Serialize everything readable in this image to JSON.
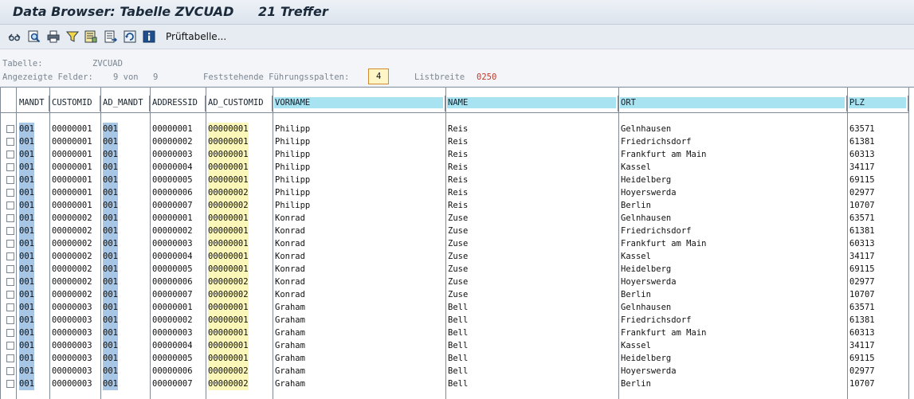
{
  "window": {
    "title": "Data Browser: Tabelle ZVCUAD",
    "hits": "21 Treffer"
  },
  "toolbar": {
    "icons": [
      "glasses-icon",
      "find-icon",
      "print-icon",
      "filter-icon",
      "layout-icon",
      "export-icon",
      "refresh-icon",
      "info-icon"
    ],
    "check_table_label": "Prüftabelle..."
  },
  "info": {
    "table_label": "Tabelle:",
    "table_value": "ZVCUAD",
    "fields_label": "Angezeigte Felder:",
    "fields_value": "9 von",
    "fields_total": "9",
    "fixed_cols_label": "Feststehende Führungsspalten:",
    "fixed_cols_value": "4",
    "list_width_label": "Listbreite",
    "list_width_value": "0250"
  },
  "table": {
    "columns": [
      "MANDT",
      "CUSTOMID",
      "AD_MANDT",
      "ADDRESSID",
      "AD_CUSTOMID",
      "VORNAME",
      "NAME",
      "ORT",
      "PLZ"
    ],
    "rows": [
      [
        "001",
        "00000001",
        "001",
        "00000001",
        "00000001",
        "Philipp",
        "Reis",
        "Gelnhausen",
        "63571"
      ],
      [
        "001",
        "00000001",
        "001",
        "00000002",
        "00000001",
        "Philipp",
        "Reis",
        "Friedrichsdorf",
        "61381"
      ],
      [
        "001",
        "00000001",
        "001",
        "00000003",
        "00000001",
        "Philipp",
        "Reis",
        "Frankfurt am Main",
        "60313"
      ],
      [
        "001",
        "00000001",
        "001",
        "00000004",
        "00000001",
        "Philipp",
        "Reis",
        "Kassel",
        "34117"
      ],
      [
        "001",
        "00000001",
        "001",
        "00000005",
        "00000001",
        "Philipp",
        "Reis",
        "Heidelberg",
        "69115"
      ],
      [
        "001",
        "00000001",
        "001",
        "00000006",
        "00000002",
        "Philipp",
        "Reis",
        "Hoyerswerda",
        "02977"
      ],
      [
        "001",
        "00000001",
        "001",
        "00000007",
        "00000002",
        "Philipp",
        "Reis",
        "Berlin",
        "10707"
      ],
      [
        "001",
        "00000002",
        "001",
        "00000001",
        "00000001",
        "Konrad",
        "Zuse",
        "Gelnhausen",
        "63571"
      ],
      [
        "001",
        "00000002",
        "001",
        "00000002",
        "00000001",
        "Konrad",
        "Zuse",
        "Friedrichsdorf",
        "61381"
      ],
      [
        "001",
        "00000002",
        "001",
        "00000003",
        "00000001",
        "Konrad",
        "Zuse",
        "Frankfurt am Main",
        "60313"
      ],
      [
        "001",
        "00000002",
        "001",
        "00000004",
        "00000001",
        "Konrad",
        "Zuse",
        "Kassel",
        "34117"
      ],
      [
        "001",
        "00000002",
        "001",
        "00000005",
        "00000001",
        "Konrad",
        "Zuse",
        "Heidelberg",
        "69115"
      ],
      [
        "001",
        "00000002",
        "001",
        "00000006",
        "00000002",
        "Konrad",
        "Zuse",
        "Hoyerswerda",
        "02977"
      ],
      [
        "001",
        "00000002",
        "001",
        "00000007",
        "00000002",
        "Konrad",
        "Zuse",
        "Berlin",
        "10707"
      ],
      [
        "001",
        "00000003",
        "001",
        "00000001",
        "00000001",
        "Graham",
        "Bell",
        "Gelnhausen",
        "63571"
      ],
      [
        "001",
        "00000003",
        "001",
        "00000002",
        "00000001",
        "Graham",
        "Bell",
        "Friedrichsdorf",
        "61381"
      ],
      [
        "001",
        "00000003",
        "001",
        "00000003",
        "00000001",
        "Graham",
        "Bell",
        "Frankfurt am Main",
        "60313"
      ],
      [
        "001",
        "00000003",
        "001",
        "00000004",
        "00000001",
        "Graham",
        "Bell",
        "Kassel",
        "34117"
      ],
      [
        "001",
        "00000003",
        "001",
        "00000005",
        "00000001",
        "Graham",
        "Bell",
        "Heidelberg",
        "69115"
      ],
      [
        "001",
        "00000003",
        "001",
        "00000006",
        "00000002",
        "Graham",
        "Bell",
        "Hoyerswerda",
        "02977"
      ],
      [
        "001",
        "00000003",
        "001",
        "00000007",
        "00000002",
        "Graham",
        "Bell",
        "Berlin",
        "10707"
      ]
    ]
  }
}
